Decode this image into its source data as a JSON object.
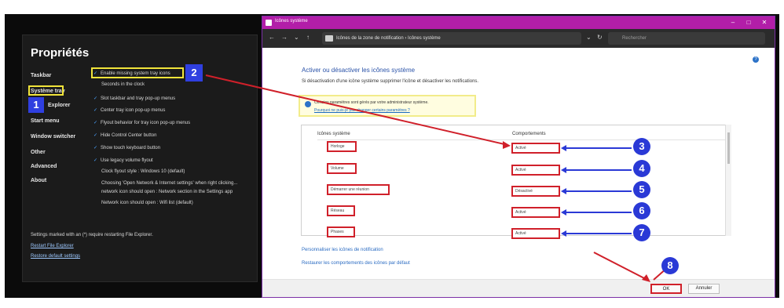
{
  "properties": {
    "title": "Propriétés",
    "sidebar": [
      "Taskbar",
      "Système tray",
      "Explorer",
      "Start menu",
      "Window switcher",
      "Other",
      "Advanced",
      "About"
    ],
    "options": [
      "Enable missing system tray icons",
      "Seconds in the clock",
      "Slot taskbar and tray pop-up menus",
      "Center tray icon pop-up menus",
      "Flyout behavior for tray icon pop-up menus",
      "Hide Control Center button",
      "Show touch keyboard button",
      "Use legacy volume flyout",
      "Clock flyout style : Windows 10 (default)",
      "Choosing 'Open Network & Internet settings' when right clicking...",
      "network icon should open : Network section in the Settings app",
      "Network icon should open : Wifi list (default)"
    ],
    "footer": [
      "Settings marked with an (*) require restarting File Explorer.",
      "Restart File Explorer",
      "Restore default settings"
    ]
  },
  "window": {
    "title": "Icônes système",
    "breadcrumb": "Icônes de la zone de notification  ›  Icônes système",
    "search_placeholder": "Rechercher",
    "heading": "Activer ou désactiver les icônes système",
    "description": "Si désactivation d'une icône système supprimer l'icône et désactiver les notifications.",
    "info_text": "Certains paramètres sont gérés par votre administrateur système.",
    "info_link": "Pourquoi ne puis-je pas changer certains paramètres ?",
    "col_icons": "Icônes système",
    "col_behaviors": "Comportements",
    "rows": [
      {
        "icon": "Horloge",
        "behavior": "Activé"
      },
      {
        "icon": "Volume",
        "behavior": "Activé"
      },
      {
        "icon": "Démarrer une réunion",
        "behavior": "Désactivé"
      },
      {
        "icon": "Réseau",
        "behavior": "Activé"
      },
      {
        "icon": "Phases",
        "behavior": "Activé"
      }
    ],
    "link_customize": "Personnaliser les icônes de notification",
    "link_restore": "Restaurer les comportements des icônes par défaut",
    "ok_label": "OK",
    "cancel_label": "Annuler"
  },
  "markers": [
    "1",
    "2",
    "3",
    "4",
    "5",
    "6",
    "7",
    "8"
  ]
}
